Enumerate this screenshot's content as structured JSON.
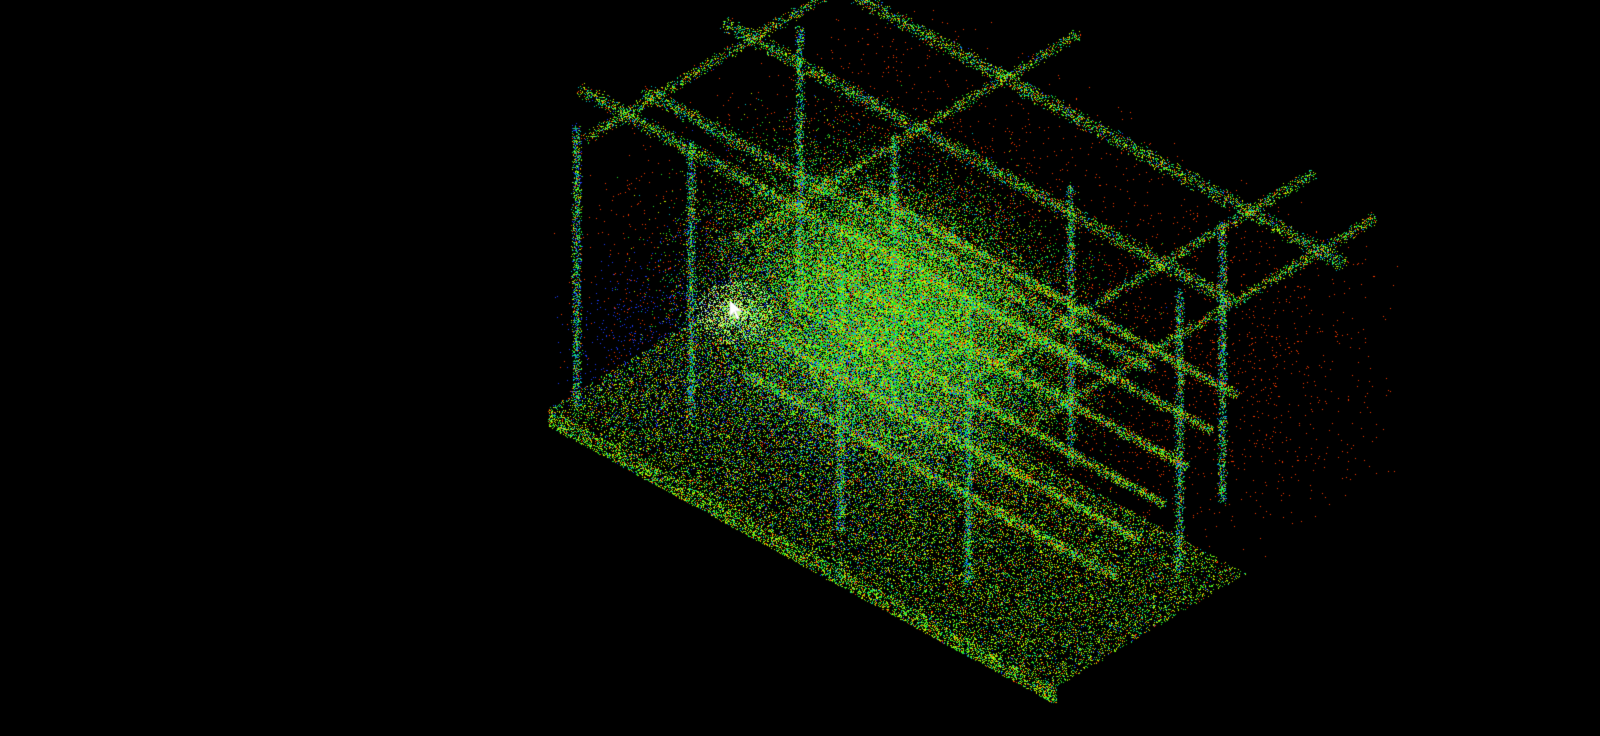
{
  "viewer": {
    "background_color": "#000000",
    "render_mode": "point-cloud",
    "color_scheme": "intensity",
    "colors": {
      "low": "#1e3cff",
      "mid_low": "#00c8c8",
      "mid": "#28e628",
      "mid_high": "#c8f000",
      "high": "#ff3c00"
    }
  }
}
